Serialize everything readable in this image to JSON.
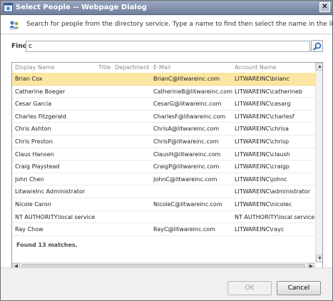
{
  "window": {
    "title": "Select People -- Webpage Dialog"
  },
  "header": {
    "description": "Search for people from the directory service. Type a name to find then select the name in the list."
  },
  "search": {
    "label": "Find",
    "value": "c"
  },
  "columns": {
    "display_name": "Display Name",
    "title": "Title",
    "department": "Department",
    "email": "E-Mail",
    "account": "Account Name"
  },
  "rows": [
    {
      "name": "Brian Cox",
      "email": "BrianC@litwareinc.com",
      "account": "LITWAREINC\\brianc",
      "selected": true
    },
    {
      "name": "Catherine Boeger",
      "email": "CatherineB@litwareinc.com",
      "account": "LITWAREINC\\catherineb"
    },
    {
      "name": "Cesar Garcia",
      "email": "CesarG@litwareinc.com",
      "account": "LITWAREINC\\cesarg"
    },
    {
      "name": "Charles Fitzgerald",
      "email": "CharlesF@litwareinc.com",
      "account": "LITWAREINC\\charlesf"
    },
    {
      "name": "Chris Ashton",
      "email": "ChrisA@litwareinc.com",
      "account": "LITWAREINC\\chrisa"
    },
    {
      "name": "Chris Preston",
      "email": "ChrisP@litwareinc.com",
      "account": "LITWAREINC\\chrisp"
    },
    {
      "name": "Claus Hansen",
      "email": "ClausH@litwareinc.com",
      "account": "LITWAREINC\\claush"
    },
    {
      "name": "Craig Playstead",
      "email": "CraigP@litwareinc.com",
      "account": "LITWAREINC\\craigp"
    },
    {
      "name": "John Chen",
      "email": "JohnC@litwareinc.com",
      "account": "LITWAREINC\\johnc"
    },
    {
      "name": "LitwareInc Administrator",
      "email": "",
      "account": "LITWAREINC\\administrator"
    },
    {
      "name": "Nicole Caron",
      "email": "NicoleC@litwareinc.com",
      "account": "LITWAREINC\\nicolec"
    },
    {
      "name": "NT AUTHORITY\\local service",
      "email": "",
      "account": "NT AUTHORITY\\local service"
    },
    {
      "name": "Ray Chow",
      "email": "RayC@litwareinc.com",
      "account": "LITWAREINC\\rayc"
    }
  ],
  "status": {
    "found": "Found 13 matches."
  },
  "buttons": {
    "ok": "OK",
    "cancel": "Cancel"
  },
  "icons": {
    "app": "ie-dialog-icon",
    "people": "people-search-icon",
    "search": "search-icon",
    "close": "close-icon"
  },
  "colors": {
    "selected_row": "#fbe6a2",
    "titlebar": "#7f8ea9"
  }
}
